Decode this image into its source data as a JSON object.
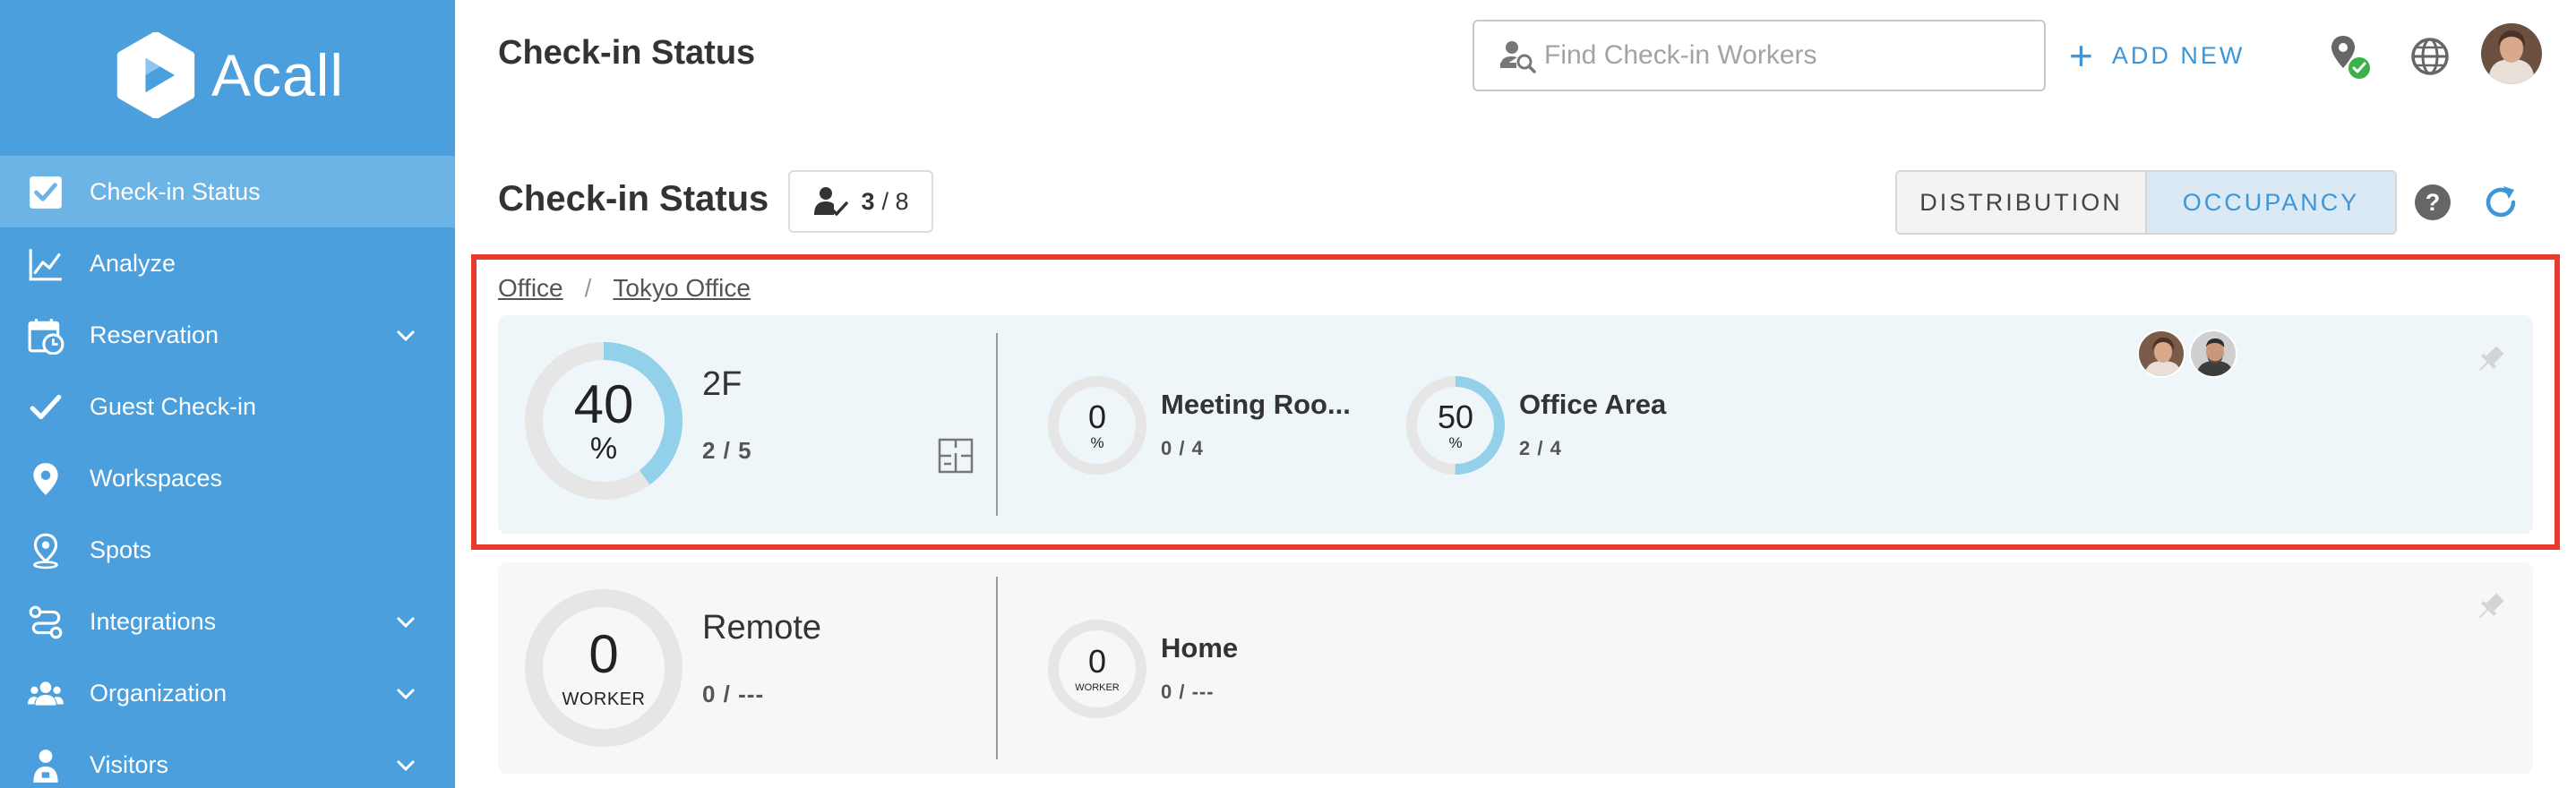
{
  "app": {
    "logo_text": "Acall"
  },
  "sidebar": {
    "items": [
      {
        "label": "Check-in Status",
        "icon": "checkbox-icon"
      },
      {
        "label": "Analyze",
        "icon": "chart-line-icon"
      },
      {
        "label": "Reservation",
        "icon": "calendar-clock-icon"
      },
      {
        "label": "Guest Check-in",
        "icon": "check-icon"
      },
      {
        "label": "Workspaces",
        "icon": "map-pin-icon"
      },
      {
        "label": "Spots",
        "icon": "pin-spot-icon"
      },
      {
        "label": "Integrations",
        "icon": "integrations-icon"
      },
      {
        "label": "Organization",
        "icon": "users-icon"
      },
      {
        "label": "Visitors",
        "icon": "visitor-icon"
      }
    ]
  },
  "header": {
    "title": "Check-in Status",
    "search_placeholder": "Find Check-in Workers",
    "add_new_label": "ADD NEW"
  },
  "section": {
    "title": "Check-in Status",
    "count_current": "3",
    "count_total": "/ 8",
    "view_toggle": {
      "distribution": "DISTRIBUTION",
      "occupancy": "OCCUPANCY",
      "selected": "OCCUPANCY"
    }
  },
  "breadcrumb": {
    "level1": "Office",
    "separator": "/",
    "level2": "Tokyo Office"
  },
  "cards": {
    "floor": {
      "name": "2F",
      "percent": "40",
      "percent_fraction": 0.4,
      "unit": "%",
      "count": "2 / 5",
      "areas": [
        {
          "name": "Meeting Roo...",
          "percent": "0",
          "percent_fraction": 0,
          "unit": "%",
          "count": "0 / 4"
        },
        {
          "name": "Office Area",
          "percent": "50",
          "percent_fraction": 0.5,
          "unit": "%",
          "count": "2 / 4"
        }
      ]
    },
    "remote": {
      "name": "Remote",
      "value": "0",
      "unit": "WORKER",
      "count": "0 / ---",
      "areas": [
        {
          "name": "Home",
          "value": "0",
          "unit": "WORKER",
          "count": "0 / ---"
        }
      ]
    }
  },
  "colors": {
    "sidebar": "#4a9fdc",
    "sidebar_active": "#6cb3e6",
    "accent": "#3c96d8",
    "donut_track": "#e6e6e6",
    "donut_fill": "#93d0ea",
    "highlight_frame": "#e63b2e"
  }
}
